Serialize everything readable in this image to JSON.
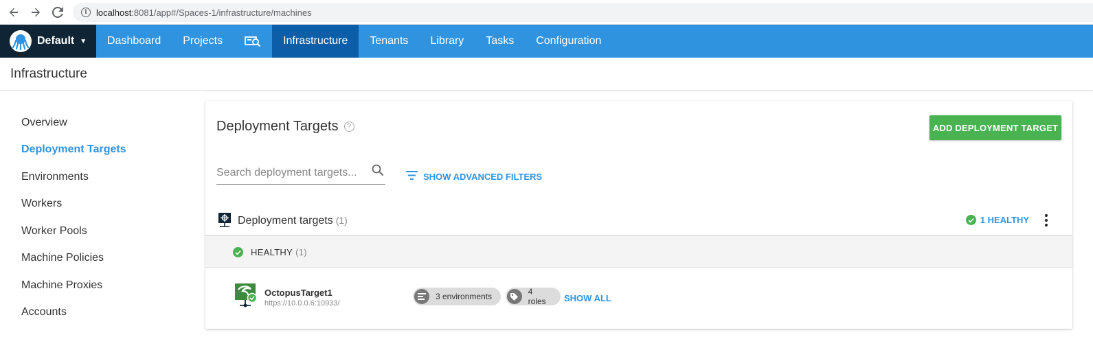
{
  "browser": {
    "url_host": "localhost",
    "url_path": ":8081/app#/Spaces-1/infrastructure/machines"
  },
  "topnav": {
    "space_name": "Default",
    "items": [
      {
        "label": "Dashboard"
      },
      {
        "label": "Projects"
      },
      {
        "label": "Infrastructure",
        "active": true
      },
      {
        "label": "Tenants"
      },
      {
        "label": "Library"
      },
      {
        "label": "Tasks"
      },
      {
        "label": "Configuration"
      }
    ],
    "search_icon": "search-machines-icon"
  },
  "page": {
    "title": "Infrastructure"
  },
  "sidebar": {
    "items": [
      {
        "label": "Overview"
      },
      {
        "label": "Deployment Targets",
        "active": true
      },
      {
        "label": "Environments"
      },
      {
        "label": "Workers"
      },
      {
        "label": "Worker Pools"
      },
      {
        "label": "Machine Policies"
      },
      {
        "label": "Machine Proxies"
      },
      {
        "label": "Accounts"
      }
    ]
  },
  "main": {
    "title": "Deployment Targets",
    "add_button": "ADD DEPLOYMENT TARGET",
    "search_placeholder": "Search deployment targets...",
    "advanced_filters": "SHOW ADVANCED FILTERS",
    "group": {
      "title": "Deployment targets",
      "count": "(1)",
      "healthy_summary": "1 HEALTHY"
    },
    "status": {
      "label": "HEALTHY",
      "count": "(1)"
    },
    "target": {
      "name": "OctopusTarget1",
      "url": "https://10.0.0.6:10933/",
      "environments": "3 environments",
      "roles": "4 roles",
      "show_all": "SHOW ALL"
    }
  },
  "colors": {
    "brand_blue": "#2f93e0",
    "nav_active": "#0d5ea8",
    "space_dark": "#0f2535",
    "success_green": "#48b350"
  }
}
